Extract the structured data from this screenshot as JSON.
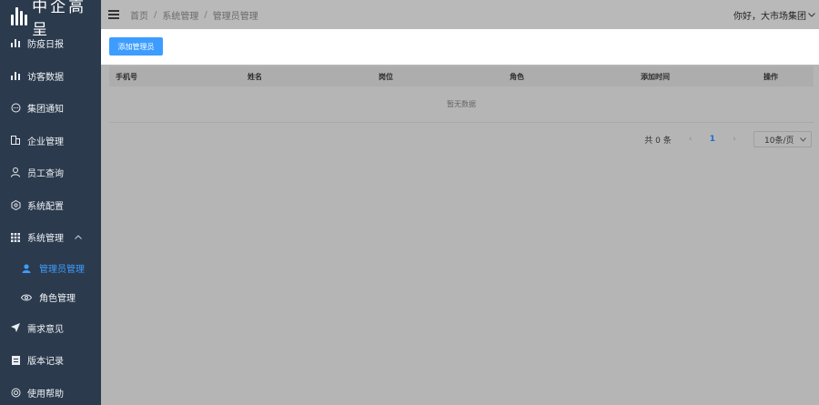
{
  "brand": {
    "name": "中企高呈"
  },
  "sidebar": {
    "items": [
      {
        "label": "防疫日报",
        "icon": "bar-chart-icon"
      },
      {
        "label": "访客数据",
        "icon": "bar-chart-icon"
      },
      {
        "label": "集团通知",
        "icon": "message-icon"
      },
      {
        "label": "企业管理",
        "icon": "building-icon"
      },
      {
        "label": "员工查询",
        "icon": "user-icon"
      },
      {
        "label": "系统配置",
        "icon": "settings-icon"
      },
      {
        "label": "系统管理",
        "icon": "grid-icon",
        "expanded": true
      },
      {
        "label": "需求意见",
        "icon": "send-icon"
      },
      {
        "label": "版本记录",
        "icon": "document-icon"
      },
      {
        "label": "使用帮助",
        "icon": "help-icon"
      }
    ],
    "subitems": [
      {
        "label": "管理员管理",
        "icon": "user-icon",
        "active": true
      },
      {
        "label": "角色管理",
        "icon": "eye-icon"
      }
    ]
  },
  "header": {
    "breadcrumb": [
      "首页",
      "系统管理",
      "管理员管理"
    ],
    "separator": "/",
    "greeting": "你好，大市场集团"
  },
  "toolbar": {
    "add_label": "添加管理员"
  },
  "table": {
    "columns": [
      "手机号",
      "姓名",
      "岗位",
      "角色",
      "添加时间",
      "操作"
    ],
    "rows": [],
    "empty_text": "暂无数据"
  },
  "pagination": {
    "total_text": "共 0 条",
    "current_page": "1",
    "page_size": "10条/页",
    "prev": "‹",
    "next": "›"
  },
  "colors": {
    "sidebar": "#2b3a4d",
    "accent": "#3d9dff",
    "overlay": "#b5b5b5"
  }
}
